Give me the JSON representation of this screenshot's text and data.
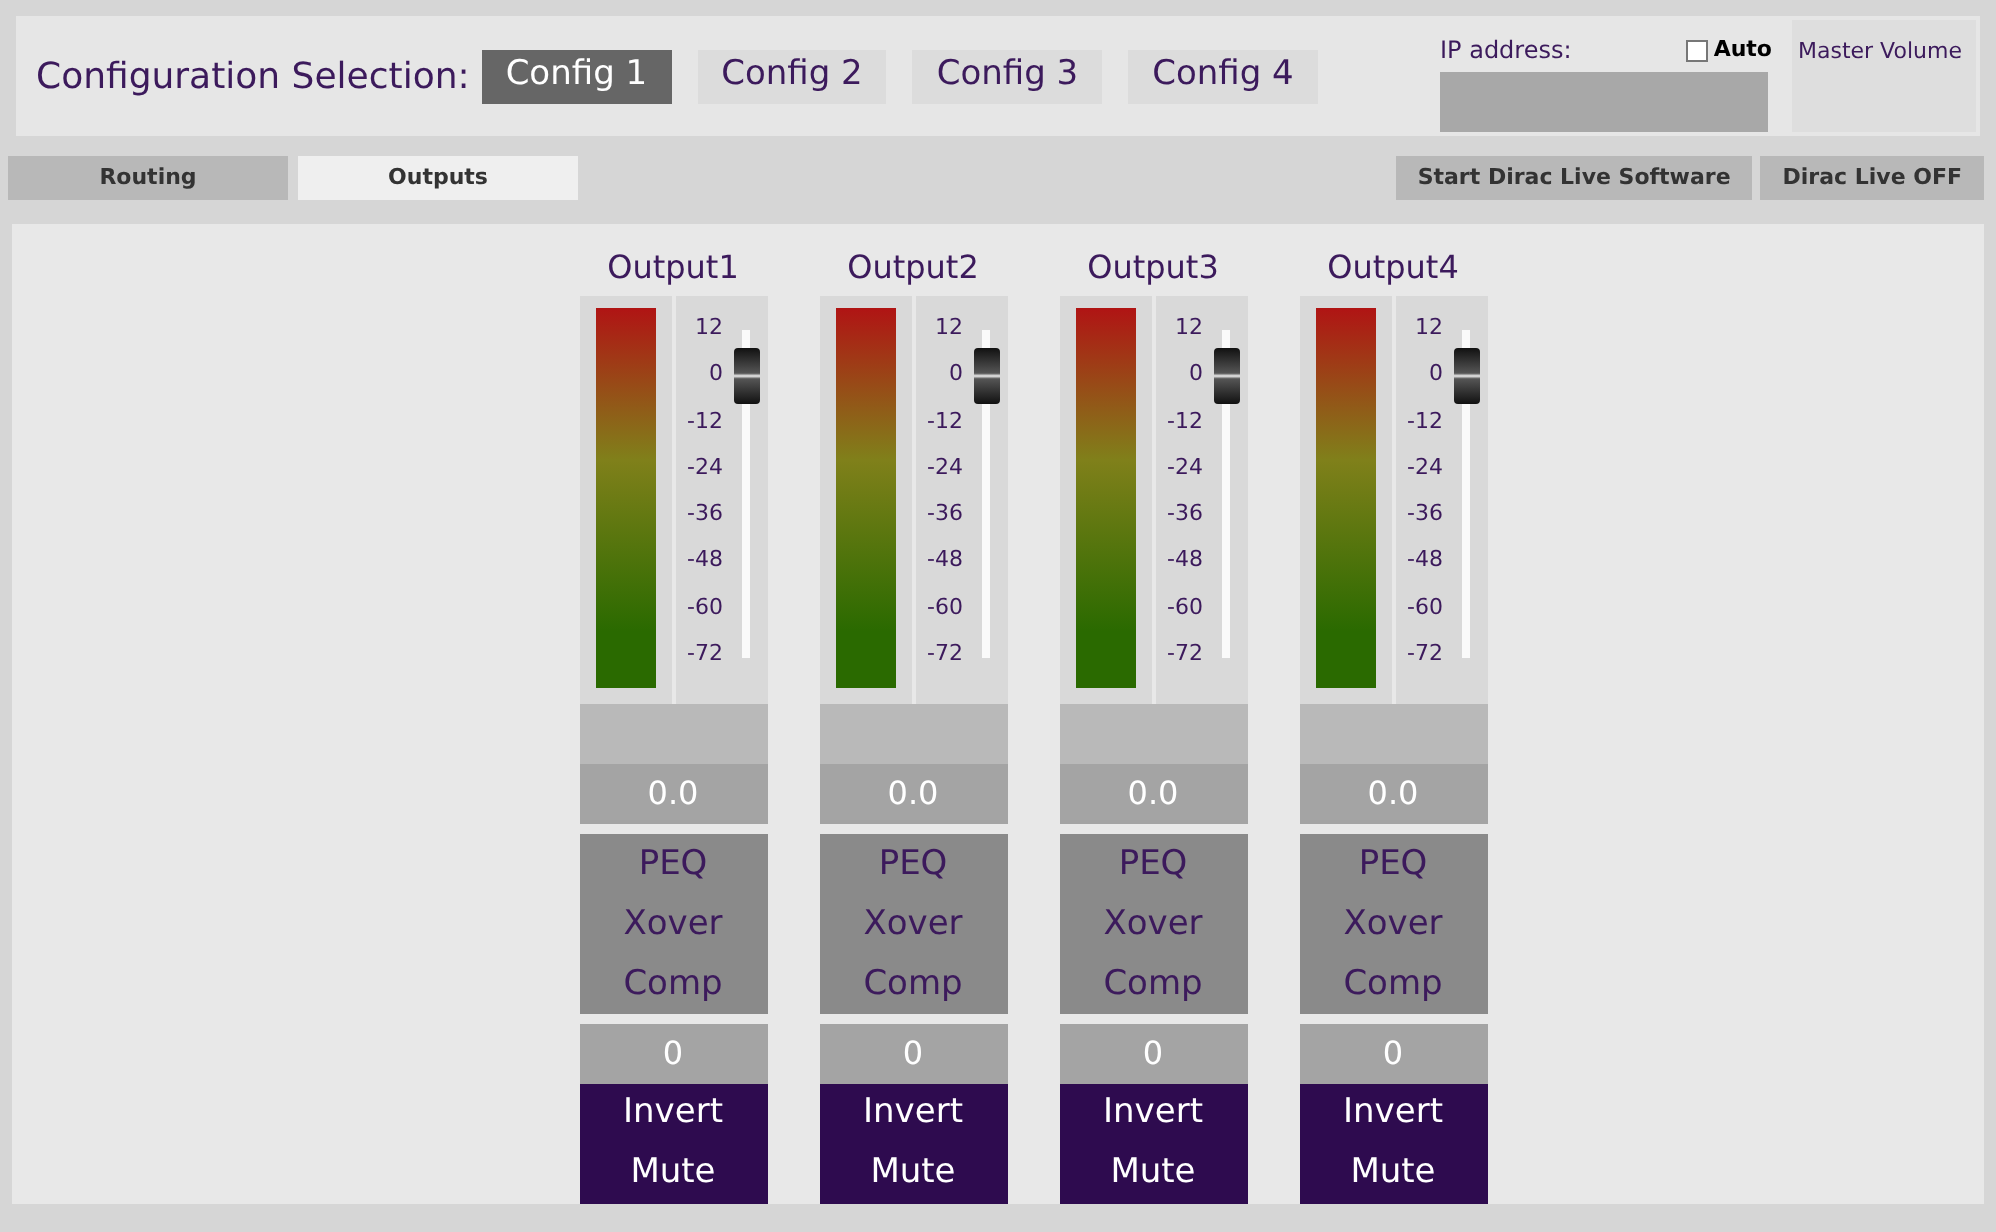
{
  "config_selection": {
    "label": "Configuration Selection:",
    "configs": [
      {
        "label": "Config 1",
        "selected": true
      },
      {
        "label": "Config 2",
        "selected": false
      },
      {
        "label": "Config 3",
        "selected": false
      },
      {
        "label": "Config 4",
        "selected": false
      }
    ]
  },
  "ip_address": {
    "label": "IP address:",
    "auto": {
      "label": "Auto",
      "checked": false
    }
  },
  "master_volume": {
    "label": "Master Volume"
  },
  "tabs": [
    {
      "label": "Routing",
      "selected": false
    },
    {
      "label": "Outputs",
      "selected": true
    }
  ],
  "actions": [
    "Start Dirac Live Software",
    "Dirac Live OFF"
  ],
  "outputs": [
    {
      "name": "Output1",
      "scale": [
        "12",
        "0",
        "-12",
        "-24",
        "-36",
        "-48",
        "-60",
        "-72"
      ],
      "fader": {
        "level": 0.857
      },
      "gain": "0.0",
      "processing": [
        "PEQ",
        "Xover",
        "Comp"
      ],
      "delay": "0",
      "buttons": [
        "Invert",
        "Mute"
      ]
    },
    {
      "name": "Output2",
      "scale": [
        "12",
        "0",
        "-12",
        "-24",
        "-36",
        "-48",
        "-60",
        "-72"
      ],
      "fader": {
        "level": 0.857
      },
      "gain": "0.0",
      "processing": [
        "PEQ",
        "Xover",
        "Comp"
      ],
      "delay": "0",
      "buttons": [
        "Invert",
        "Mute"
      ]
    },
    {
      "name": "Output3",
      "scale": [
        "12",
        "0",
        "-12",
        "-24",
        "-36",
        "-48",
        "-60",
        "-72"
      ],
      "fader": {
        "level": 0.857
      },
      "gain": "0.0",
      "processing": [
        "PEQ",
        "Xover",
        "Comp"
      ],
      "delay": "0",
      "buttons": [
        "Invert",
        "Mute"
      ]
    },
    {
      "name": "Output4",
      "scale": [
        "12",
        "0",
        "-12",
        "-24",
        "-36",
        "-48",
        "-60",
        "-72"
      ],
      "fader": {
        "level": 0.857
      },
      "gain": "0.0",
      "processing": [
        "PEQ",
        "Xover",
        "Comp"
      ],
      "delay": "0",
      "buttons": [
        "Invert",
        "Mute"
      ]
    }
  ]
}
